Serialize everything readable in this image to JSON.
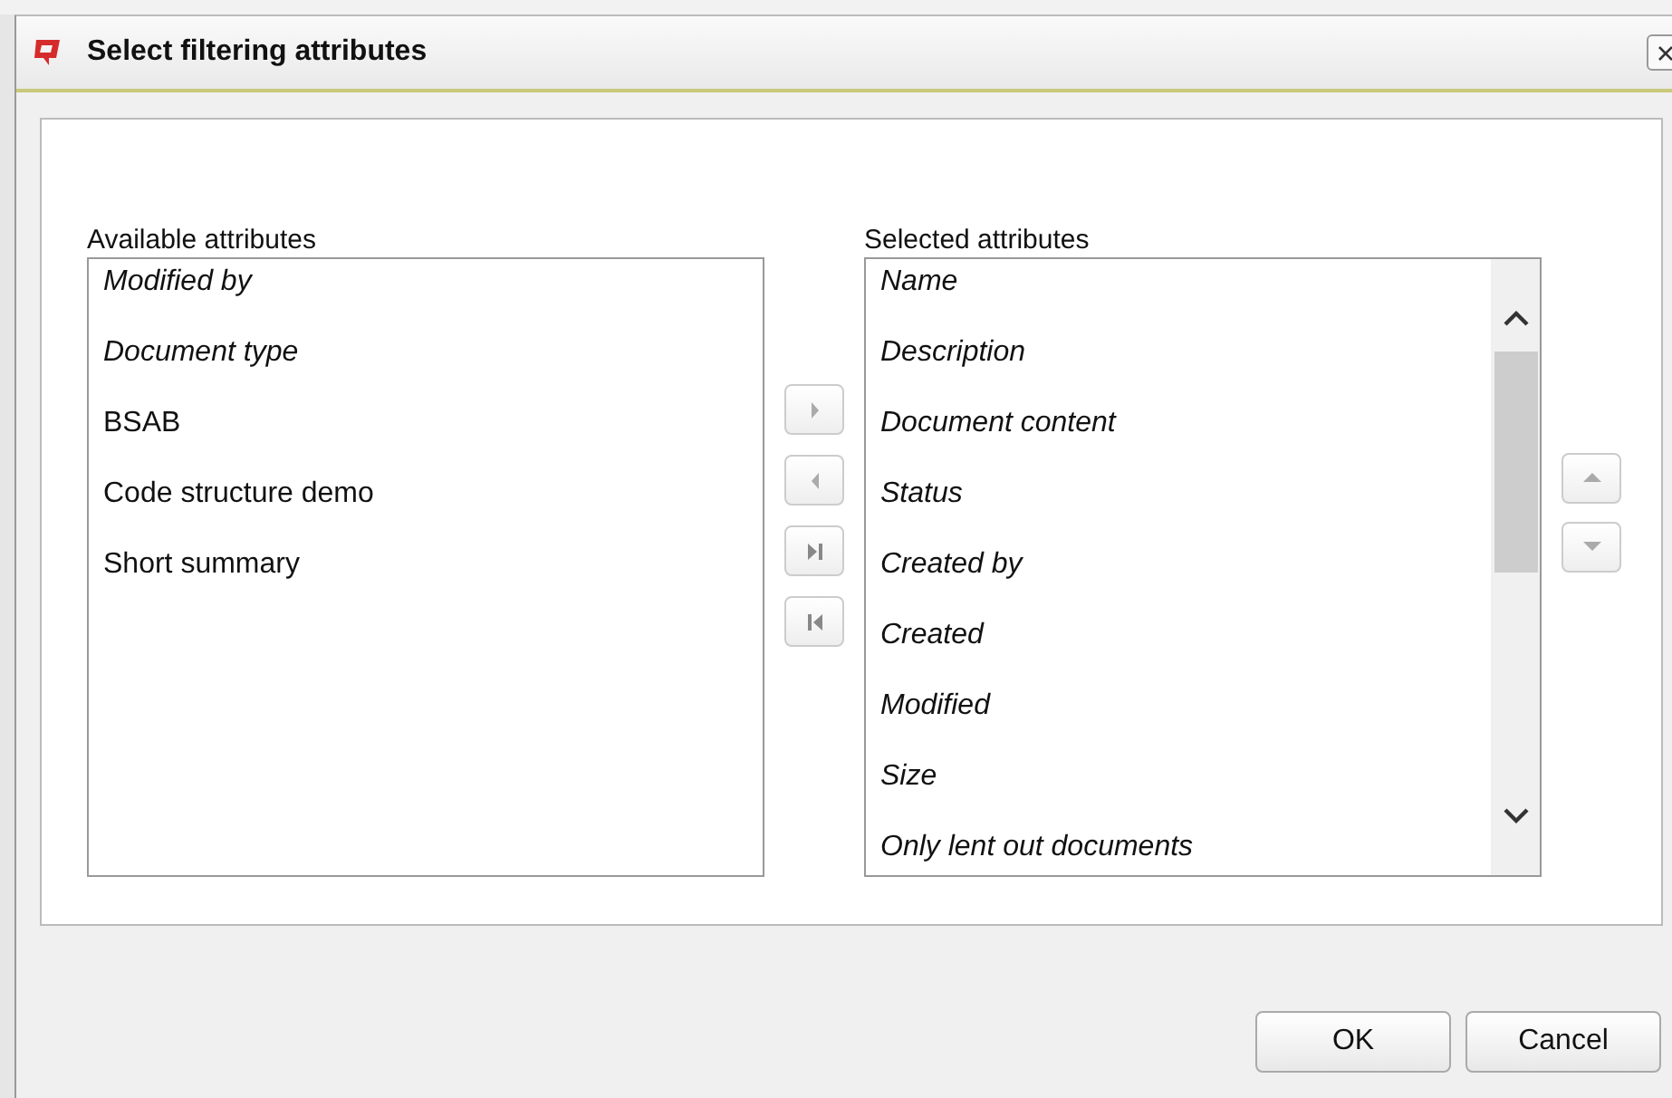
{
  "window": {
    "title": "Select filtering attributes"
  },
  "available": {
    "label": "Available attributes",
    "items": [
      {
        "text": "Modified by",
        "italic": true
      },
      {
        "text": "Document type",
        "italic": true
      },
      {
        "text": "BSAB",
        "italic": false
      },
      {
        "text": "Code structure demo",
        "italic": false
      },
      {
        "text": "Short summary",
        "italic": false
      }
    ]
  },
  "selected": {
    "label": "Selected attributes",
    "items": [
      {
        "text": "Name",
        "italic": true
      },
      {
        "text": "Description",
        "italic": true
      },
      {
        "text": "Document content",
        "italic": true
      },
      {
        "text": "Status",
        "italic": true
      },
      {
        "text": "Created by",
        "italic": true
      },
      {
        "text": "Created",
        "italic": true
      },
      {
        "text": "Modified",
        "italic": true
      },
      {
        "text": "Size",
        "italic": true
      },
      {
        "text": "Only lent out documents",
        "italic": true
      }
    ]
  },
  "buttons": [
    "OK",
    "Cancel"
  ]
}
